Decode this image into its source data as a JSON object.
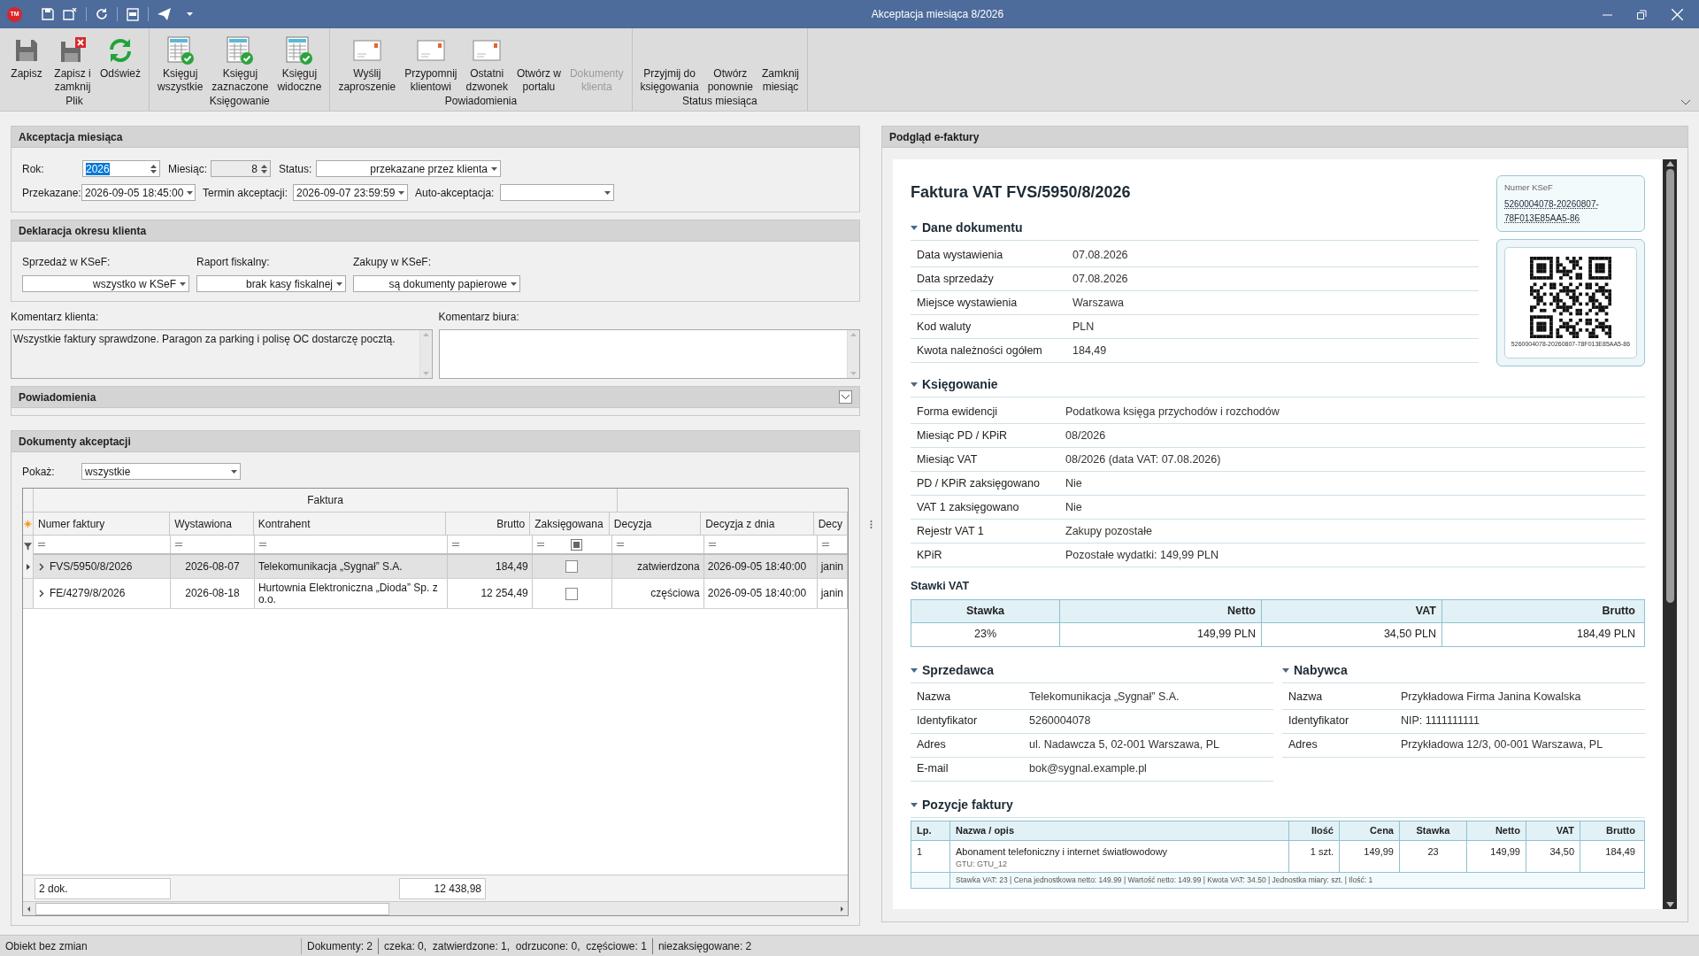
{
  "window": {
    "logo": "TM",
    "title": "Akceptacja miesiąca 8/2026"
  },
  "ribbon": {
    "groups": [
      {
        "label": "Plik",
        "buttons": [
          {
            "label": "Zapisz",
            "kind": "save",
            "disabled": false
          },
          {
            "label": "Zapisz i\nzamknij",
            "kind": "save-close",
            "disabled": false
          },
          {
            "label": "Odśwież",
            "kind": "refresh",
            "disabled": false
          }
        ]
      },
      {
        "label": "Księgowanie",
        "buttons": [
          {
            "label": "Księguj\nwszystkie",
            "kind": "post",
            "disabled": false
          },
          {
            "label": "Księguj\nzaznaczone",
            "kind": "post",
            "disabled": false
          },
          {
            "label": "Księguj\nwidoczne",
            "kind": "post",
            "disabled": false
          }
        ]
      },
      {
        "label": "Powiadomienia",
        "buttons": [
          {
            "label": "Wyślij\nzaproszenie",
            "kind": "mail",
            "disabled": false
          },
          {
            "label": "Przypomnij\nklientowi",
            "kind": "mail",
            "disabled": false
          },
          {
            "label": "Ostatni\ndzwonek",
            "kind": "mail",
            "disabled": false
          },
          {
            "label": "Otwórz w\nportalu",
            "kind": "none",
            "disabled": false
          },
          {
            "label": "Dokumenty\nklienta",
            "kind": "none",
            "disabled": true
          }
        ]
      },
      {
        "label": "Status miesiąca",
        "buttons": [
          {
            "label": "Przyjmij do\nksięgowania",
            "kind": "none",
            "disabled": false
          },
          {
            "label": "Otwórz\nponownie",
            "kind": "none",
            "disabled": false
          },
          {
            "label": "Zamknij\nmiesiąc",
            "kind": "none",
            "disabled": false
          }
        ]
      }
    ]
  },
  "acceptance": {
    "title": "Akceptacja miesiąca",
    "year": {
      "label": "Rok:",
      "value": "2026"
    },
    "month": {
      "label": "Miesiąc:",
      "value": "8",
      "disabled": true
    },
    "status": {
      "label": "Status:",
      "value": "przekazane przez klienta"
    },
    "submitted": {
      "label": "Przekazane:",
      "value": "2026-09-05 18:45:00"
    },
    "deadline": {
      "label": "Termin akceptacji:",
      "value": "2026-09-07 23:59:59"
    },
    "auto": {
      "label": "Auto-akceptacja:"
    }
  },
  "declaration": {
    "title": "Deklaracja okresu klienta",
    "fields": [
      {
        "label": "Sprzedaż w KSeF:",
        "value": "wszystko w KSeF"
      },
      {
        "label": "Raport fiskalny:",
        "value": "brak kasy fiskalnej"
      },
      {
        "label": "Zakupy w KSeF:",
        "value": "są dokumenty papierowe"
      }
    ]
  },
  "comments": [
    {
      "label": "Komentarz klienta:",
      "value": "Wszystkie faktury sprawdzone. Paragon za parking i polisę OC dostarczę pocztą.",
      "readonly": true
    },
    {
      "label": "Komentarz biura:",
      "readonly": false
    }
  ],
  "notifications": {
    "title": "Powiadomienia",
    "expanded": false
  },
  "documents": {
    "title": "Dokumenty akceptacji",
    "filter": {
      "label": "Pokaż:",
      "value": "wszystkie"
    },
    "band": "Faktura",
    "columns": [
      {
        "label": "Numer faktury",
        "kind": "text"
      },
      {
        "label": "Wystawiona",
        "kind": "text"
      },
      {
        "label": "Kontrahent",
        "kind": "text"
      },
      {
        "label": "Brutto",
        "kind": "text"
      },
      {
        "label": "Zaksięgowana",
        "kind": "check",
        "filter_indeterminate": true
      },
      {
        "label": "Decyzja",
        "kind": "text"
      },
      {
        "label": "Decyzja z dnia",
        "kind": "text"
      },
      {
        "label": "Decy",
        "kind": "text"
      }
    ],
    "rows": [
      {
        "selected": true,
        "cells": [
          "FVS/5950/8/2026",
          "2026-08-07",
          "Telekomunikacja „Sygnał” S.A.",
          "184,49",
          false,
          "zatwierdzona",
          "2026-09-05 18:40:00",
          "janin"
        ]
      },
      {
        "selected": false,
        "cells": [
          "FE/4279/8/2026",
          "2026-08-18",
          "Hurtownia Elektroniczna „Dioda” Sp. z o.o.",
          "12 254,49",
          false,
          "częściowa",
          "2026-09-05 18:40:00",
          "janin"
        ]
      }
    ],
    "footer": {
      "count": "2 dok.",
      "total": "12 438,98"
    }
  },
  "preview": {
    "title": "Podgląd e-faktury",
    "heading": "Faktura VAT FVS/5950/8/2026",
    "ksef": {
      "label": "Numer KSeF",
      "number": "5260004078-20260807-78F013E85AA5-86",
      "qr_caption": "5260004078-20260807-78F013E85AA5-86"
    },
    "document": {
      "title": "Dane dokumentu",
      "rows": [
        [
          "Data wystawienia",
          "07.08.2026"
        ],
        [
          "Data sprzedaży",
          "07.08.2026"
        ],
        [
          "Miejsce wystawienia",
          "Warszawa"
        ],
        [
          "Kod waluty",
          "PLN"
        ],
        [
          "Kwota należności ogółem",
          "184,49"
        ]
      ]
    },
    "accounting": {
      "title": "Księgowanie",
      "rows": [
        [
          "Forma ewidencji",
          "Podatkowa księga przychodów i rozchodów"
        ],
        [
          "Miesiąc PD / KPiR",
          "08/2026"
        ],
        [
          "Miesiąc VAT",
          "08/2026 (data VAT: 07.08.2026)"
        ],
        [
          "PD / KPiR zaksięgowano",
          "Nie"
        ],
        [
          "VAT 1 zaksięgowano",
          "Nie"
        ],
        [
          "Rejestr VAT 1",
          "Zakupy pozostałe"
        ],
        [
          "KPiR",
          "Pozostałe wydatki: 149,99 PLN"
        ]
      ]
    },
    "vat": {
      "title": "Stawki VAT",
      "columns": [
        "Stawka",
        "Netto",
        "VAT",
        "Brutto"
      ],
      "rows": [
        [
          "23%",
          "149,99 PLN",
          "34,50 PLN",
          "184,49 PLN"
        ]
      ]
    },
    "seller": {
      "title": "Sprzedawca",
      "rows": [
        [
          "Nazwa",
          "Telekomunikacja „Sygnał” S.A."
        ],
        [
          "Identyfikator",
          "5260004078"
        ],
        [
          "Adres",
          "ul. Nadawcza 5, 02-001 Warszawa, PL"
        ],
        [
          "E-mail",
          "bok@sygnal.example.pl"
        ]
      ]
    },
    "buyer": {
      "title": "Nabywca",
      "rows": [
        [
          "Nazwa",
          "Przykładowa Firma Janina Kowalska"
        ],
        [
          "Identyfikator",
          "NIP: 1111111111"
        ],
        [
          "Adres",
          "Przykładowa 12/3, 00-001 Warszawa, PL"
        ]
      ]
    },
    "items": {
      "title": "Pozycje faktury",
      "columns": [
        "Lp.",
        "Nazwa / opis",
        "Ilość",
        "Cena",
        "Stawka",
        "Netto",
        "VAT",
        "Brutto"
      ],
      "rows": [
        {
          "cells": [
            "1",
            "Abonament telefoniczny i internet światłowodowy",
            "1 szt.",
            "149,99",
            "23",
            "149,99",
            "34,50",
            "184,49"
          ],
          "note": "GTU: GTU_12",
          "detail": "Stawka VAT: 23 | Cena jednostkowa netto: 149.99 | Wartość netto: 149.99 | Kwota VAT: 34.50 | Jednostka miary: szt. | Ilość: 1"
        }
      ]
    }
  },
  "status_bar": [
    "Obiekt bez zmian",
    "Dokumenty: 2",
    "czeka: 0,  zatwierdzone: 1,  odrzucone: 0,  częściowe: 1",
    "niezaksięgowane: 2"
  ]
}
